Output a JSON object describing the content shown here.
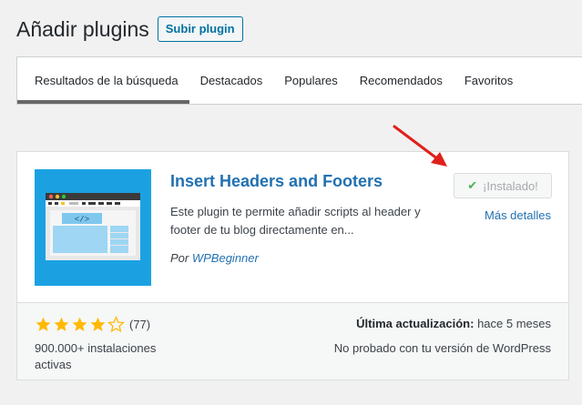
{
  "header": {
    "title": "Añadir plugins",
    "upload_label": "Subir plugin"
  },
  "tabs": [
    {
      "label": "Resultados de la búsqueda"
    },
    {
      "label": "Destacados"
    },
    {
      "label": "Populares"
    },
    {
      "label": "Recomendados"
    },
    {
      "label": "Favoritos"
    }
  ],
  "plugin": {
    "name": "Insert Headers and Footers",
    "description": "Este plugin te permite añadir scripts al header y footer de tu blog directamente en...",
    "author_prefix": "Por",
    "author": "WPBeginner",
    "installed_label": "¡Instalado!",
    "more_details": "Más detalles",
    "rating_stars": 4.5,
    "rating_count": "(77)",
    "installs": "900.000+ instalaciones activas",
    "last_updated_label": "Última actualización:",
    "last_updated_value": "hace 5 meses",
    "compatibility": "No probado con tu versión de WordPress",
    "thumbnail_color": "#1ba1e2",
    "thumb_code": "</>"
  },
  "colors": {
    "link": "#2271b1",
    "star": "#ffb900",
    "arrow": "#e0201b",
    "check": "#46b450"
  }
}
